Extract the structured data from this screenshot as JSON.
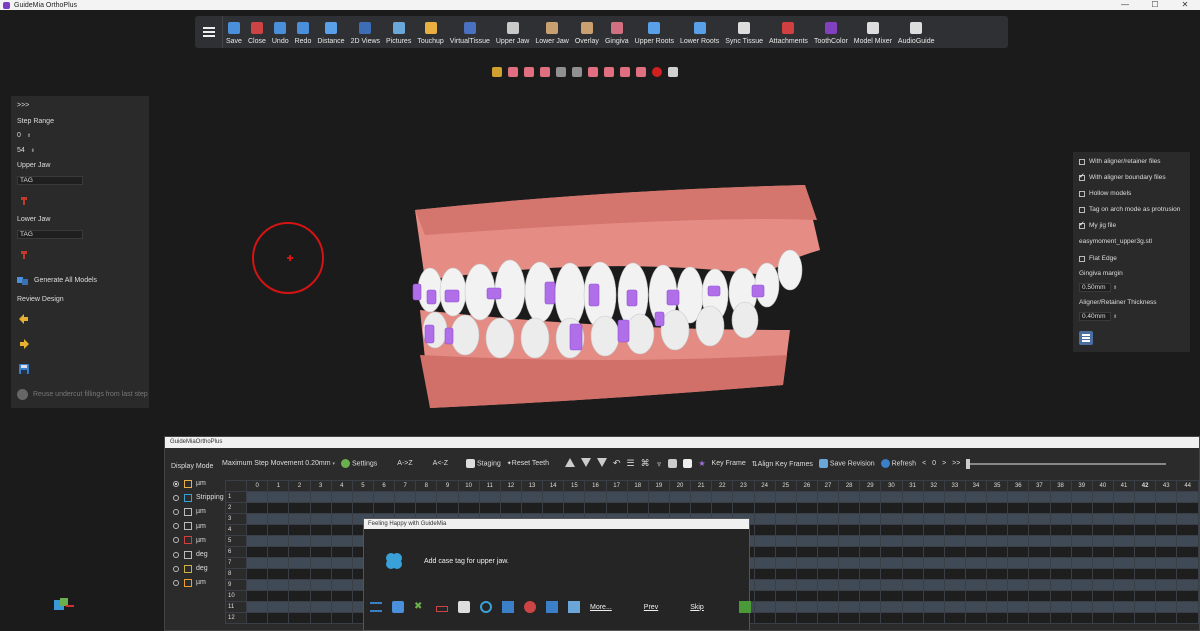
{
  "app": {
    "title": "GuideMia OrthoPlus",
    "window_buttons": [
      "—",
      "☐",
      "✕"
    ]
  },
  "toolbar": {
    "items": [
      {
        "label": "Save",
        "color": "#4a8fd9"
      },
      {
        "label": "Close",
        "color": "#c44"
      },
      {
        "label": "Undo",
        "color": "#4a8fd9"
      },
      {
        "label": "Redo",
        "color": "#4a8fd9"
      },
      {
        "label": "Distance",
        "color": "#5aa0e8"
      },
      {
        "label": "2D Views",
        "color": "#3d6db5"
      },
      {
        "label": "Pictures",
        "color": "#6aa6d8"
      },
      {
        "label": "Touchup",
        "color": "#e8b040"
      },
      {
        "label": "VirtualTissue",
        "color": "#4a70c0"
      },
      {
        "label": "Upper Jaw",
        "color": "#c9c9c9"
      },
      {
        "label": "Lower Jaw",
        "color": "#c9a070"
      },
      {
        "label": "Overlay",
        "color": "#c9a070"
      },
      {
        "label": "Gingiva",
        "color": "#d07080"
      },
      {
        "label": "Upper Roots",
        "color": "#5aa0e8"
      },
      {
        "label": "Lower Roots",
        "color": "#5aa0e8"
      },
      {
        "label": "Sync Tissue",
        "color": "#dddddd"
      },
      {
        "label": "Attachments",
        "color": "#d04040"
      },
      {
        "label": "ToothColor",
        "color": "#8040c0"
      },
      {
        "label": "Model Mixer",
        "color": "#dddddd"
      },
      {
        "label": "AudioGuide",
        "color": "#dddddd"
      }
    ]
  },
  "viewbar": {
    "icons": [
      "#d0a030",
      "#e07080",
      "#e07080",
      "#e07080",
      "#909090",
      "#909090",
      "#e07080",
      "#e07080",
      "#e07080",
      "#e07080",
      "#d02020",
      "#d0d0d0"
    ]
  },
  "left_panel": {
    "collapse": ">>>",
    "step_range_label": "Step Range",
    "step_from": "0",
    "step_to": "54",
    "upper_jaw_label": "Upper Jaw",
    "upper_tag": "TAG",
    "lower_jaw_label": "Lower Jaw",
    "lower_tag": "TAG",
    "generate_label": "Generate All Models",
    "review_label": "Review Design",
    "reuse_label": "Reuse undercut fillings from last step"
  },
  "right_panel": {
    "options": [
      {
        "label": "With aligner/retainer files",
        "checked": false
      },
      {
        "label": "With aligner boundary files",
        "checked": true
      },
      {
        "label": "Hollow models",
        "checked": false
      },
      {
        "label": "Tag on arch mode as protrusion",
        "checked": false
      },
      {
        "label": "My jig file",
        "checked": true
      }
    ],
    "jig_file": "easymoment_upper3g.stl",
    "flat_edge": "Flat Edge",
    "gingiva_margin_label": "Gingiva margin",
    "gingiva_margin": "0.50mm",
    "thickness_label": "Aligner/Retainer Thickness",
    "thickness": "0.40mm"
  },
  "bottom": {
    "title": "GuideMiaOrthoPlus",
    "max_step": "Maximum Step Movement",
    "max_step_value": "0.20mm",
    "settings": "Settings",
    "az": "A->Z",
    "za": "A<-Z",
    "staging": "Staging",
    "reset": "Reset Teeth",
    "key_frame": "Key Frame",
    "align_key": "Align Key Frames",
    "save_revision": "Save Revision",
    "refresh": "Refresh",
    "step_value": "0",
    "nav_prev": "<",
    "nav_next": ">",
    "nav_end": ">>",
    "display_mode_label": "Display Mode",
    "display_modes": [
      {
        "label": "µm",
        "selected": true
      },
      {
        "label": "Stripping",
        "selected": false
      },
      {
        "label": "µm",
        "selected": false
      },
      {
        "label": "µm",
        "selected": false
      },
      {
        "label": "µm",
        "selected": false
      },
      {
        "label": "deg",
        "selected": false
      },
      {
        "label": "deg",
        "selected": false
      },
      {
        "label": "µm",
        "selected": false
      }
    ],
    "columns": [
      "0",
      "1",
      "2",
      "3",
      "4",
      "5",
      "6",
      "7",
      "8",
      "9",
      "10",
      "11",
      "12",
      "13",
      "14",
      "15",
      "16",
      "17",
      "18",
      "19",
      "20",
      "21",
      "22",
      "23",
      "24",
      "25",
      "26",
      "27",
      "28",
      "29",
      "30",
      "31",
      "32",
      "33",
      "34",
      "35",
      "36",
      "37",
      "38",
      "39",
      "40",
      "41",
      "42",
      "43",
      "44"
    ],
    "rows": [
      "1",
      "2",
      "3",
      "4",
      "5",
      "6",
      "7",
      "8",
      "9",
      "10",
      "11",
      "12"
    ]
  },
  "popup": {
    "title": "Feeling Happy with GuideMia",
    "message": "Add case tag for upper jaw.",
    "more": "More...",
    "prev": "Prev",
    "skip": "Skip"
  }
}
